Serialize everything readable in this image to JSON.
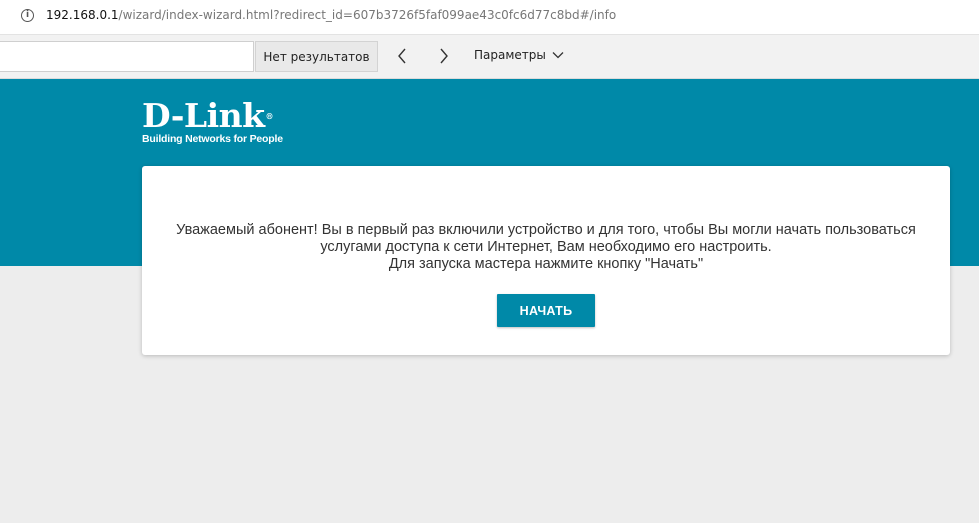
{
  "browser": {
    "url_host": "192.168.0.1",
    "url_path": "/wizard/index-wizard.html?redirect_id=607b3726f5faf099ae43c0fc6d77c8bd#/info"
  },
  "findbar": {
    "query": "",
    "results_label": "Нет результатов",
    "params_label": "Параметры"
  },
  "brand": {
    "logo_text": "D-Link",
    "tagline": "Building Networks for People",
    "color": "#0089a8"
  },
  "dialog": {
    "message_line1": "Уважаемый абонент! Вы в первый раз включили устройство и для того, чтобы Вы могли начать пользоваться",
    "message_line2": "услугами доступа к сети Интернет, Вам необходимо его настроить.",
    "message_line3": "Для запуска мастера нажмите кнопку \"Начать\"",
    "start_button": "НАЧАТЬ"
  },
  "icons": {
    "info": "info-icon",
    "prev": "chevron-left-icon",
    "next": "chevron-right-icon",
    "dropdown": "chevron-down-icon"
  }
}
